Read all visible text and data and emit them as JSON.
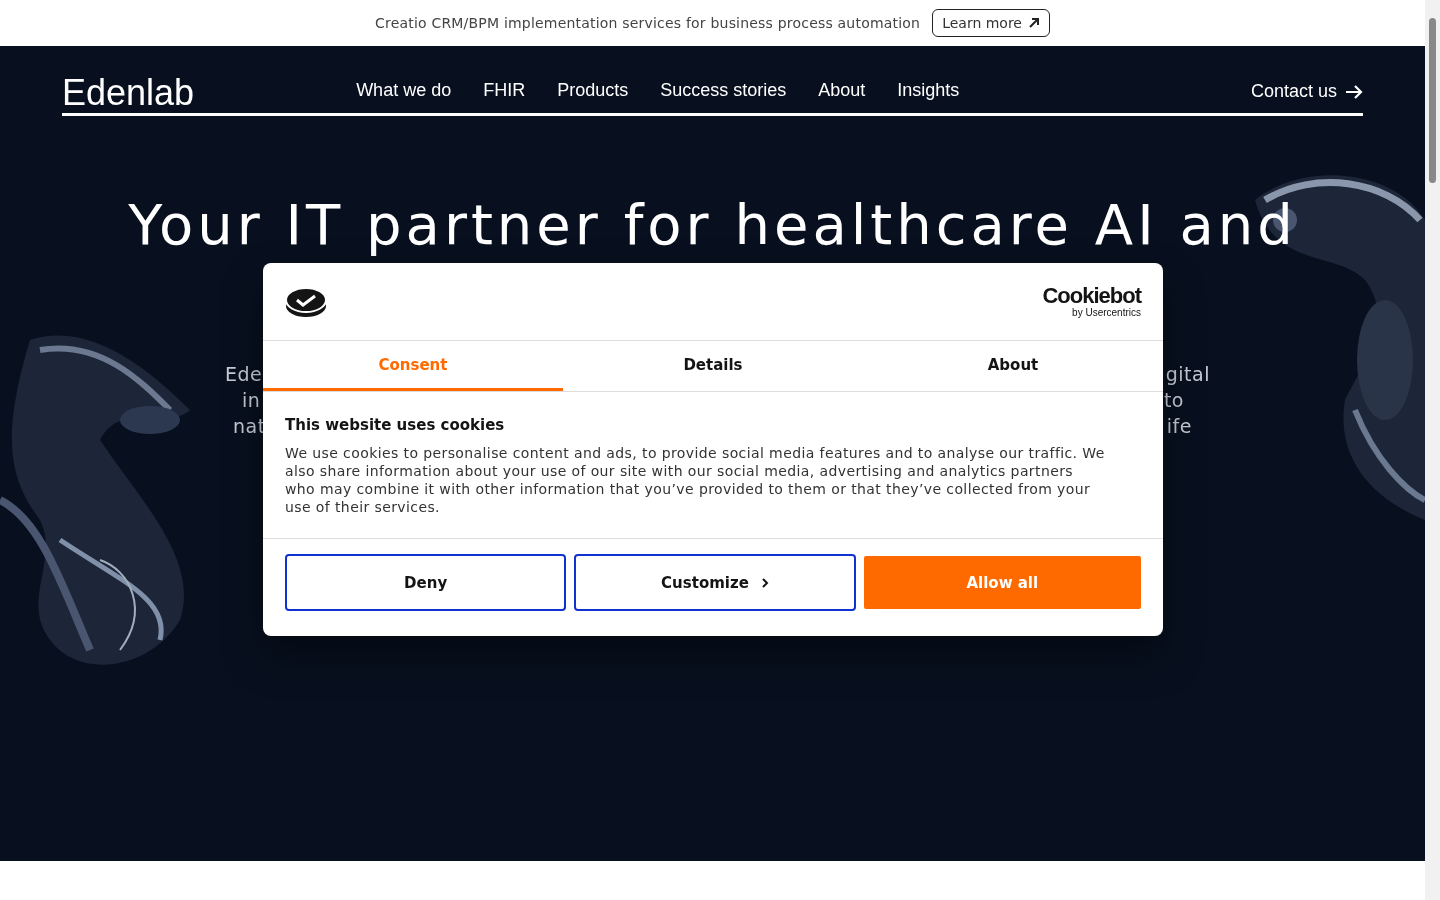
{
  "banner": {
    "text": "Creatio CRM/BPM implementation services for business process automation",
    "button": "Learn more"
  },
  "header": {
    "logo": "Edenlab",
    "nav": [
      "What we do",
      "FHIR",
      "Products",
      "Success stories",
      "About",
      "Insights"
    ],
    "contact": "Contact us"
  },
  "hero": {
    "title": "Your IT partner for healthcare AI and",
    "fragments": [
      {
        "left": "Ede",
        "right": "gital"
      },
      {
        "left": "in",
        "right": "to"
      },
      {
        "left": "nat",
        "right": "ife"
      }
    ]
  },
  "cookie_dialog": {
    "brand": "Cookiebot",
    "brand_sub": "by Usercentrics",
    "tabs": [
      {
        "label": "Consent",
        "selected": true
      },
      {
        "label": "Details",
        "selected": false
      },
      {
        "label": "About",
        "selected": false
      }
    ],
    "heading": "This website uses cookies",
    "body": "We use cookies to personalise content and ads, to provide social media features and to analyse our traffic. We also share information about your use of our site with our social media, advertising and analytics partners who may combine it with other information that you’ve provided to them or that they’ve collected from your use of their services.",
    "buttons": [
      {
        "label": "Deny",
        "kind": "outline"
      },
      {
        "label": "Customize",
        "kind": "chevron"
      },
      {
        "label": "Allow all",
        "kind": "primary"
      }
    ]
  }
}
